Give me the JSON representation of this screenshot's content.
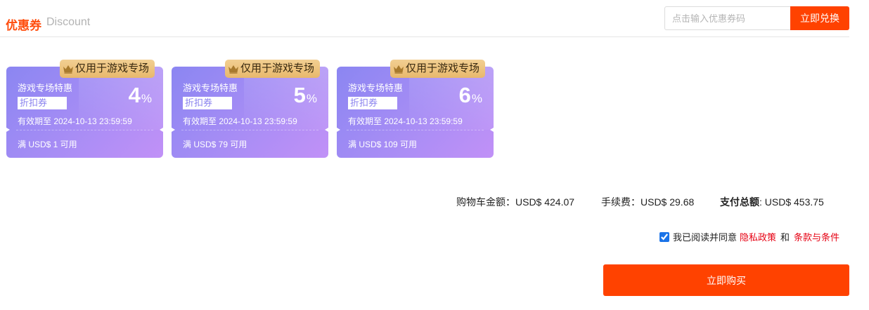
{
  "header": {
    "title_cn": "优惠券",
    "title_en": "Discount",
    "code_placeholder": "点击输入优惠券码",
    "redeem_label": "立即兑换"
  },
  "coupons": [
    {
      "tag": "仅用于游戏专场",
      "name": "游戏专场特惠",
      "type": "折扣券",
      "value": "4",
      "unit": "%",
      "valid": "有效期至 2024-10-13 23:59:59",
      "condition": "满 USD$ 1 可用"
    },
    {
      "tag": "仅用于游戏专场",
      "name": "游戏专场特惠",
      "type": "折扣券",
      "value": "5",
      "unit": "%",
      "valid": "有效期至 2024-10-13 23:59:59",
      "condition": "满 USD$ 79 可用"
    },
    {
      "tag": "仅用于游戏专场",
      "name": "游戏专场特惠",
      "type": "折扣券",
      "value": "6",
      "unit": "%",
      "valid": "有效期至 2024-10-13 23:59:59",
      "condition": "满 USD$ 109 可用"
    }
  ],
  "summary": {
    "cart_label": "购物车金额：",
    "cart_value": "USD$ 424.07",
    "fee_label": "手续费：",
    "fee_value": "USD$ 29.68",
    "total_label": "支付总额",
    "total_sep": ": ",
    "total_value": "USD$ 453.75"
  },
  "agreement": {
    "checked": true,
    "text": "我已阅读并同意",
    "privacy_link": "隐私政策",
    "and_text": "和",
    "terms_link": "条款与条件"
  },
  "buy_label": "立即购买",
  "colors": {
    "accent": "#ff4200",
    "link": "#e60012",
    "coupon_start": "#8b86f2",
    "coupon_end": "#c191f7",
    "tag_gold": "#e8b86c"
  },
  "icons": {
    "tag_icon": "crown-icon"
  }
}
